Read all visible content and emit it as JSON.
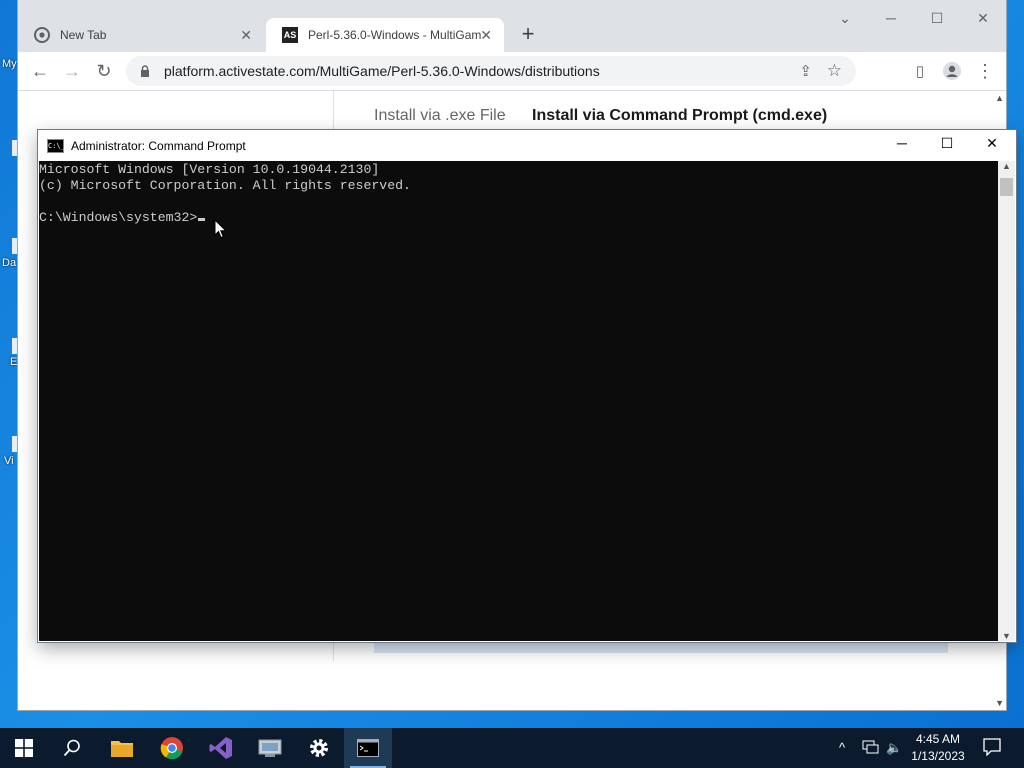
{
  "desktop": {
    "labels": [
      "My",
      "Da",
      "E",
      "Vi"
    ]
  },
  "browser": {
    "tabs": [
      {
        "title": "New Tab"
      },
      {
        "title": "Perl-5.36.0-Windows - MultiGam"
      }
    ],
    "tab_icon_text": "AS",
    "url": "platform.activestate.com/MultiGame/Perl-5.36.0-Windows/distributions",
    "page": {
      "tab_exe": "Install via .exe File",
      "tab_cmd": "Install via Command Prompt (cmd.exe)"
    }
  },
  "cmd": {
    "title": "Administrator:  Command Prompt",
    "icon_text": "C:\\_",
    "lines": [
      "Microsoft Windows [Version 10.0.19044.2130]",
      "(c) Microsoft Corporation. All rights reserved.",
      "",
      "C:\\Windows\\system32>"
    ]
  },
  "taskbar": {
    "apps": [
      "start-icon",
      "search-icon",
      "file-explorer-icon",
      "chrome-icon",
      "visual-studio-icon",
      "server-manager-icon",
      "settings-icon",
      "command-prompt-icon"
    ],
    "time": "4:45 AM",
    "date": "1/13/2023"
  },
  "colors": {
    "desktop": "#1177d6",
    "taskbar": "#0b1b2d",
    "cmd_bg": "#0c0c0c",
    "cmd_text": "#cccccc"
  }
}
